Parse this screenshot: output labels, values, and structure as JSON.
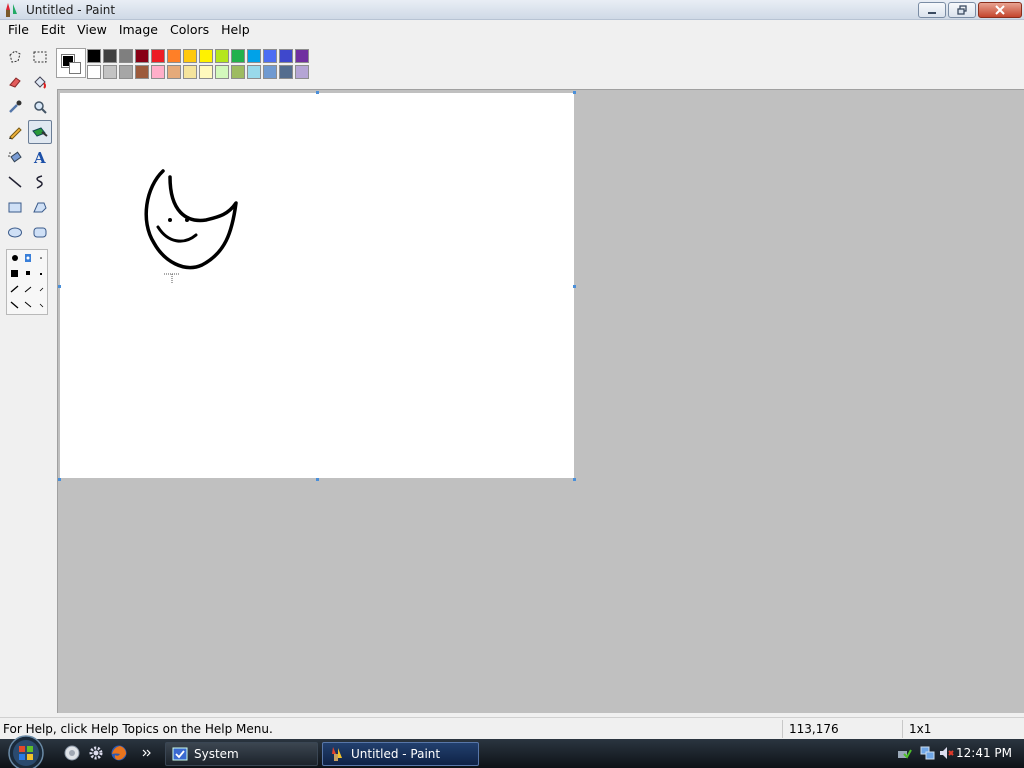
{
  "window": {
    "title": "Untitled - Paint",
    "controls": [
      "minimize",
      "maximize",
      "close"
    ]
  },
  "menu": [
    "File",
    "Edit",
    "View",
    "Image",
    "Colors",
    "Help"
  ],
  "tools": [
    "free-form-select",
    "select",
    "eraser",
    "fill-with-color",
    "pick-color",
    "magnifier",
    "pencil",
    "brush",
    "airbrush",
    "text",
    "line",
    "curve",
    "rectangle",
    "polygon",
    "ellipse",
    "rounded-rectangle"
  ],
  "active_tool": "brush",
  "palette": {
    "foreground": "#000000",
    "background": "#ffffff",
    "row1": [
      "#000000",
      "#404040",
      "#7f7f7f",
      "#880015",
      "#ed1c24",
      "#ff7f27",
      "#ffc90e",
      "#fff200",
      "#b5e61d",
      "#22b14c",
      "#00a2e8",
      "#4d6df3",
      "#3f48cc",
      "#7030a0"
    ],
    "row2": [
      "#ffffff",
      "#c3c3c3",
      "#a6a6a6",
      "#9c5a3c",
      "#ffaec9",
      "#e5aa7a",
      "#f5e49c",
      "#fff9bd",
      "#d3f9bc",
      "#9dbb61",
      "#99d9ea",
      "#709ad1",
      "#546d8e",
      "#b5a5d5"
    ]
  },
  "canvas": {
    "drawing": "moon-face sketch"
  },
  "status": {
    "help_text": "For Help, click Help Topics on the Help Menu.",
    "coords": "113,176",
    "size": "1x1"
  },
  "taskbar": {
    "items": [
      "System",
      "Untitled - Paint"
    ],
    "active": "Untitled - Paint",
    "clock": "12:41 PM"
  }
}
